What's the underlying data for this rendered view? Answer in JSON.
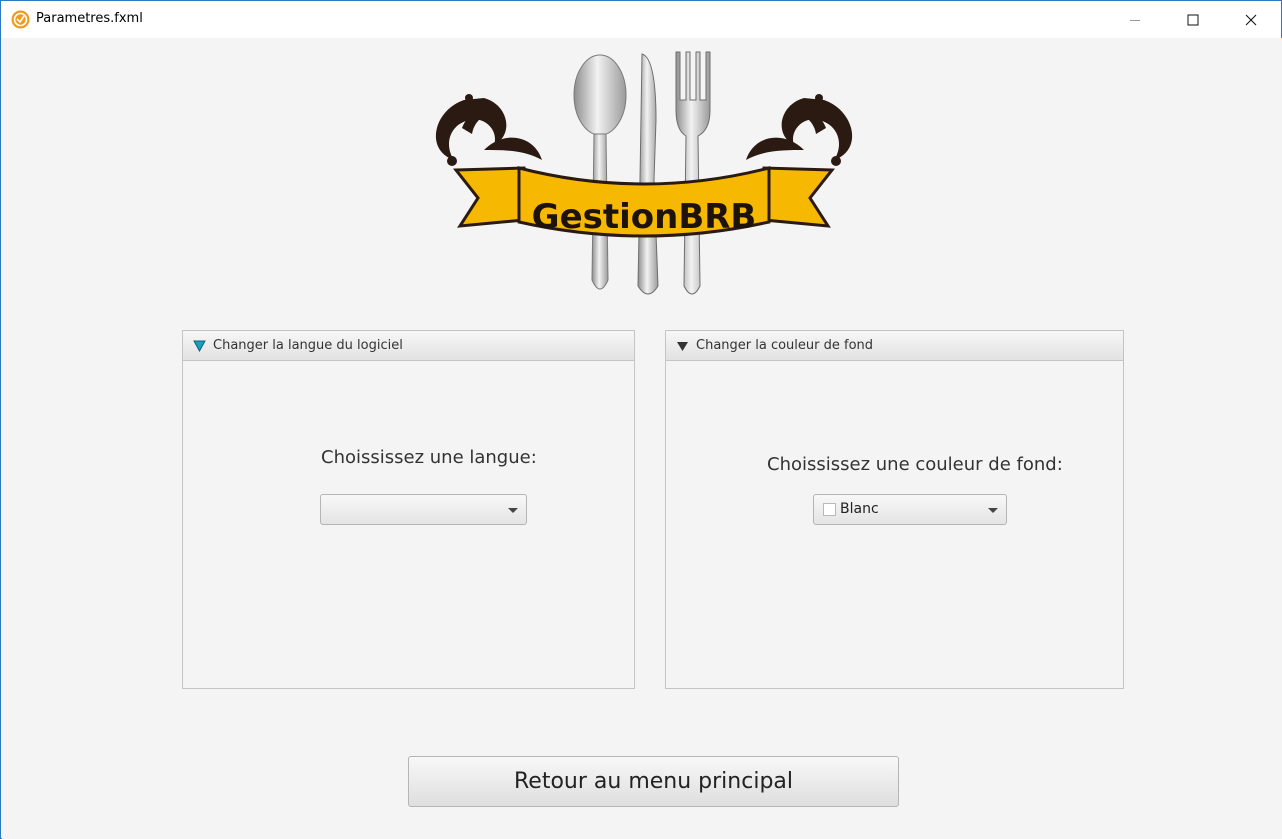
{
  "window": {
    "title": "Parametres.fxml",
    "controls": {
      "minimize": "minimize-icon",
      "maximize": "maximize-icon",
      "close": "close-icon"
    }
  },
  "logo": {
    "text": "GestionBRB",
    "ribbon_color": "#f6b800"
  },
  "language_pane": {
    "header": "Changer la langue du logiciel",
    "prompt": "Choississez une langue:",
    "selected_value": ""
  },
  "color_pane": {
    "header": "Changer la couleur de fond",
    "prompt": "Choississez une couleur de fond:",
    "selected_value": "Blanc",
    "selected_color": "#ffffff"
  },
  "actions": {
    "back_label": "Retour au menu principal"
  },
  "colors": {
    "window_border": "#2b79c2",
    "background": "#f4f4f4",
    "expanded_arrow": "#1a9fc4"
  }
}
